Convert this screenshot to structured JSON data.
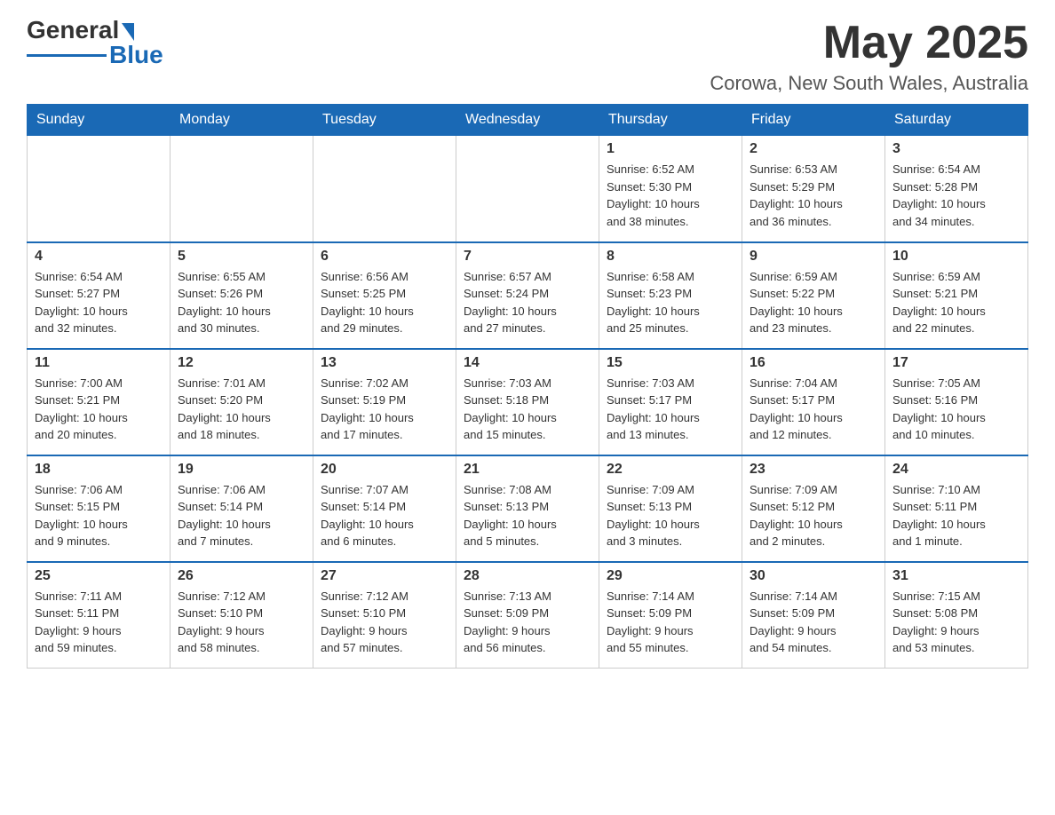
{
  "header": {
    "logo_text_general": "General",
    "logo_text_blue": "Blue",
    "month_title": "May 2025",
    "subtitle": "Corowa, New South Wales, Australia"
  },
  "days_of_week": [
    "Sunday",
    "Monday",
    "Tuesday",
    "Wednesday",
    "Thursday",
    "Friday",
    "Saturday"
  ],
  "weeks": [
    [
      {
        "day": "",
        "info": ""
      },
      {
        "day": "",
        "info": ""
      },
      {
        "day": "",
        "info": ""
      },
      {
        "day": "",
        "info": ""
      },
      {
        "day": "1",
        "info": "Sunrise: 6:52 AM\nSunset: 5:30 PM\nDaylight: 10 hours\nand 38 minutes."
      },
      {
        "day": "2",
        "info": "Sunrise: 6:53 AM\nSunset: 5:29 PM\nDaylight: 10 hours\nand 36 minutes."
      },
      {
        "day": "3",
        "info": "Sunrise: 6:54 AM\nSunset: 5:28 PM\nDaylight: 10 hours\nand 34 minutes."
      }
    ],
    [
      {
        "day": "4",
        "info": "Sunrise: 6:54 AM\nSunset: 5:27 PM\nDaylight: 10 hours\nand 32 minutes."
      },
      {
        "day": "5",
        "info": "Sunrise: 6:55 AM\nSunset: 5:26 PM\nDaylight: 10 hours\nand 30 minutes."
      },
      {
        "day": "6",
        "info": "Sunrise: 6:56 AM\nSunset: 5:25 PM\nDaylight: 10 hours\nand 29 minutes."
      },
      {
        "day": "7",
        "info": "Sunrise: 6:57 AM\nSunset: 5:24 PM\nDaylight: 10 hours\nand 27 minutes."
      },
      {
        "day": "8",
        "info": "Sunrise: 6:58 AM\nSunset: 5:23 PM\nDaylight: 10 hours\nand 25 minutes."
      },
      {
        "day": "9",
        "info": "Sunrise: 6:59 AM\nSunset: 5:22 PM\nDaylight: 10 hours\nand 23 minutes."
      },
      {
        "day": "10",
        "info": "Sunrise: 6:59 AM\nSunset: 5:21 PM\nDaylight: 10 hours\nand 22 minutes."
      }
    ],
    [
      {
        "day": "11",
        "info": "Sunrise: 7:00 AM\nSunset: 5:21 PM\nDaylight: 10 hours\nand 20 minutes."
      },
      {
        "day": "12",
        "info": "Sunrise: 7:01 AM\nSunset: 5:20 PM\nDaylight: 10 hours\nand 18 minutes."
      },
      {
        "day": "13",
        "info": "Sunrise: 7:02 AM\nSunset: 5:19 PM\nDaylight: 10 hours\nand 17 minutes."
      },
      {
        "day": "14",
        "info": "Sunrise: 7:03 AM\nSunset: 5:18 PM\nDaylight: 10 hours\nand 15 minutes."
      },
      {
        "day": "15",
        "info": "Sunrise: 7:03 AM\nSunset: 5:17 PM\nDaylight: 10 hours\nand 13 minutes."
      },
      {
        "day": "16",
        "info": "Sunrise: 7:04 AM\nSunset: 5:17 PM\nDaylight: 10 hours\nand 12 minutes."
      },
      {
        "day": "17",
        "info": "Sunrise: 7:05 AM\nSunset: 5:16 PM\nDaylight: 10 hours\nand 10 minutes."
      }
    ],
    [
      {
        "day": "18",
        "info": "Sunrise: 7:06 AM\nSunset: 5:15 PM\nDaylight: 10 hours\nand 9 minutes."
      },
      {
        "day": "19",
        "info": "Sunrise: 7:06 AM\nSunset: 5:14 PM\nDaylight: 10 hours\nand 7 minutes."
      },
      {
        "day": "20",
        "info": "Sunrise: 7:07 AM\nSunset: 5:14 PM\nDaylight: 10 hours\nand 6 minutes."
      },
      {
        "day": "21",
        "info": "Sunrise: 7:08 AM\nSunset: 5:13 PM\nDaylight: 10 hours\nand 5 minutes."
      },
      {
        "day": "22",
        "info": "Sunrise: 7:09 AM\nSunset: 5:13 PM\nDaylight: 10 hours\nand 3 minutes."
      },
      {
        "day": "23",
        "info": "Sunrise: 7:09 AM\nSunset: 5:12 PM\nDaylight: 10 hours\nand 2 minutes."
      },
      {
        "day": "24",
        "info": "Sunrise: 7:10 AM\nSunset: 5:11 PM\nDaylight: 10 hours\nand 1 minute."
      }
    ],
    [
      {
        "day": "25",
        "info": "Sunrise: 7:11 AM\nSunset: 5:11 PM\nDaylight: 9 hours\nand 59 minutes."
      },
      {
        "day": "26",
        "info": "Sunrise: 7:12 AM\nSunset: 5:10 PM\nDaylight: 9 hours\nand 58 minutes."
      },
      {
        "day": "27",
        "info": "Sunrise: 7:12 AM\nSunset: 5:10 PM\nDaylight: 9 hours\nand 57 minutes."
      },
      {
        "day": "28",
        "info": "Sunrise: 7:13 AM\nSunset: 5:09 PM\nDaylight: 9 hours\nand 56 minutes."
      },
      {
        "day": "29",
        "info": "Sunrise: 7:14 AM\nSunset: 5:09 PM\nDaylight: 9 hours\nand 55 minutes."
      },
      {
        "day": "30",
        "info": "Sunrise: 7:14 AM\nSunset: 5:09 PM\nDaylight: 9 hours\nand 54 minutes."
      },
      {
        "day": "31",
        "info": "Sunrise: 7:15 AM\nSunset: 5:08 PM\nDaylight: 9 hours\nand 53 minutes."
      }
    ]
  ]
}
